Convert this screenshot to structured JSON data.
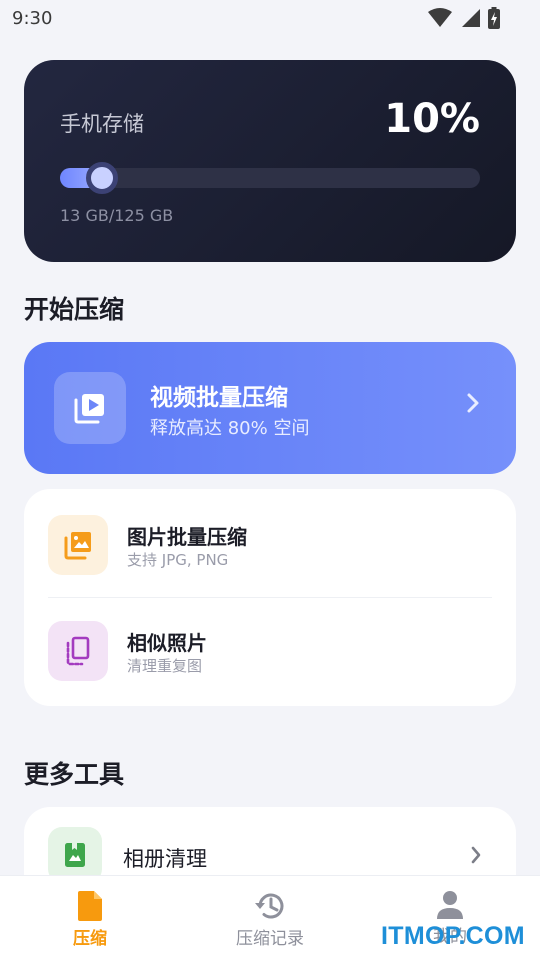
{
  "status_bar": {
    "time": "9:30",
    "icons": [
      "wifi-icon",
      "signal-icon",
      "battery-charging-icon"
    ]
  },
  "storage": {
    "title": "手机存储",
    "percent_label": "10%",
    "used_fraction": 0.1,
    "used_text": "13 GB/125 GB"
  },
  "start_section": {
    "title": "开始压缩"
  },
  "video_card": {
    "title": "视频批量压缩",
    "subtitle": "释放高达 80% 空间",
    "icon": "video-library-icon"
  },
  "tools": [
    {
      "title": "图片批量压缩",
      "subtitle": "支持 JPG, PNG",
      "icon": "image-stack-icon",
      "icon_color": "#f59c1a",
      "icon_bg": "#fdf1de"
    },
    {
      "title": "相似照片",
      "subtitle": "清理重复图",
      "icon": "copy-pages-icon",
      "icon_color": "#a33bbf",
      "icon_bg": "#f3e3f6"
    }
  ],
  "more_section": {
    "title": "更多工具"
  },
  "album": {
    "label": "相册清理",
    "icon": "photo-book-icon",
    "icon_color": "#3fa64c",
    "icon_bg": "#e5f4e6"
  },
  "bottom_nav": [
    {
      "label": "压缩",
      "icon": "file-icon",
      "active": true
    },
    {
      "label": "压缩记录",
      "icon": "history-icon",
      "active": false
    },
    {
      "label": "我的",
      "icon": "person-icon",
      "active": false
    }
  ],
  "colors": {
    "accent": "#f79a0e",
    "inactive_nav": "#8e909b",
    "watermark": "#1e8fd8"
  },
  "watermark": "ITMOP.COM"
}
